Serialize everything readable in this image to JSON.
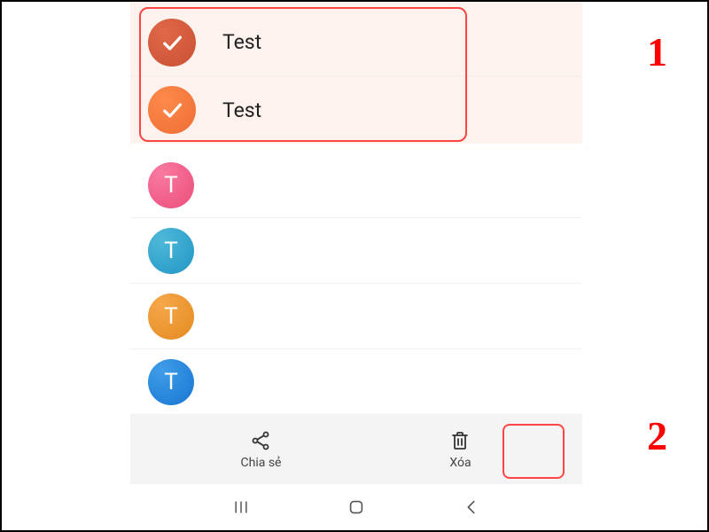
{
  "selected_contacts": [
    {
      "name": "Test",
      "avatar_letter": "",
      "color": "selected-dark"
    },
    {
      "name": "Test",
      "avatar_letter": "",
      "color": "selected-light"
    }
  ],
  "contacts": [
    {
      "avatar_letter": "T",
      "color": "pink"
    },
    {
      "avatar_letter": "T",
      "color": "cyan"
    },
    {
      "avatar_letter": "T",
      "color": "orange"
    },
    {
      "avatar_letter": "T",
      "color": "blue"
    }
  ],
  "bottom_actions": {
    "share": {
      "label": "Chia sẻ"
    },
    "delete": {
      "label": "Xóa"
    }
  },
  "annotations": {
    "one": "1",
    "two": "2"
  }
}
